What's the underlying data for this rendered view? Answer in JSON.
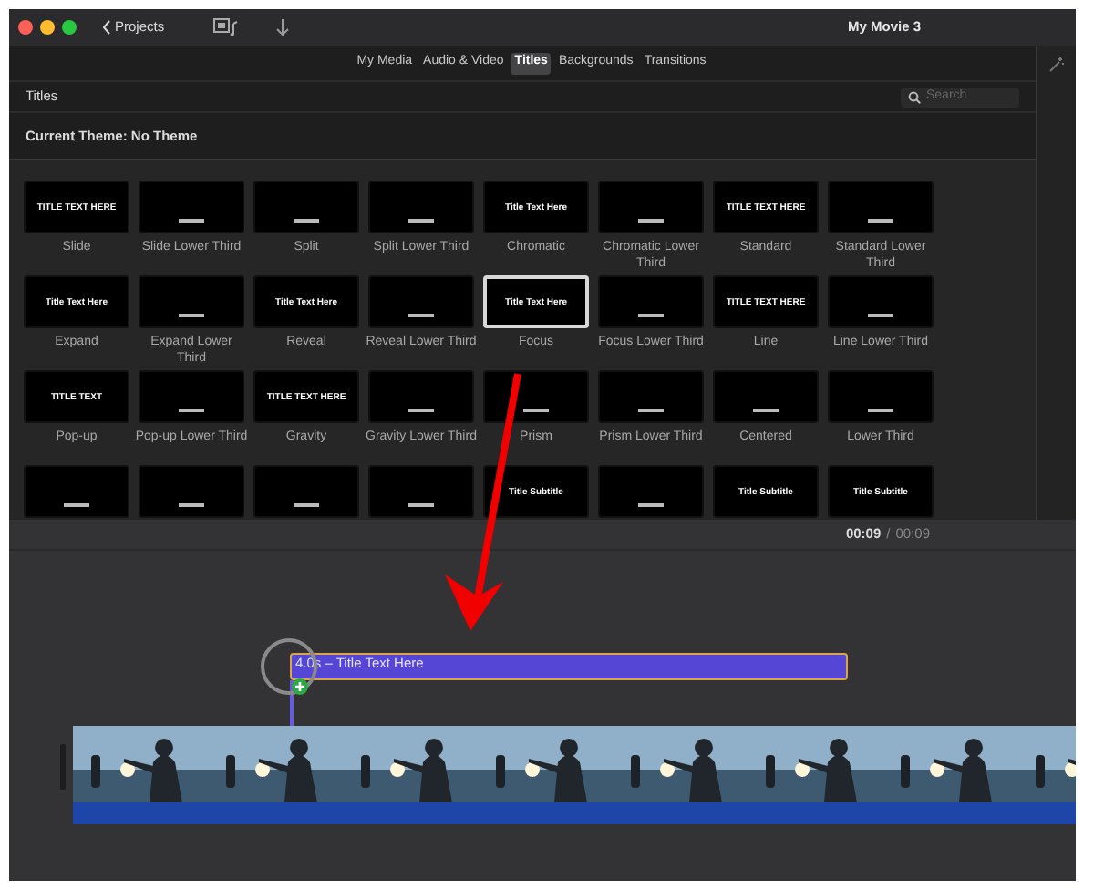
{
  "toolbar": {
    "back": "Projects",
    "title": "My Movie 3"
  },
  "tabs": [
    {
      "label": "My Media",
      "selected": false
    },
    {
      "label": "Audio & Video",
      "selected": false
    },
    {
      "label": "Titles",
      "selected": true
    },
    {
      "label": "Backgrounds",
      "selected": false
    },
    {
      "label": "Transitions",
      "selected": false
    }
  ],
  "browser": {
    "heading": "Titles",
    "search": {
      "placeholder": "Search"
    },
    "theme": "Current Theme: No Theme"
  },
  "titles": [
    {
      "label": "Slide",
      "selected": false,
      "preview": "TITLE TEXT HERE"
    },
    {
      "label": "Slide Lower Third",
      "selected": false
    },
    {
      "label": "Split",
      "selected": false
    },
    {
      "label": "Split Lower Third",
      "selected": false
    },
    {
      "label": "Chromatic",
      "selected": false,
      "preview": "Title Text Here"
    },
    {
      "label": "Chromatic Lower Third",
      "selected": false
    },
    {
      "label": "Standard",
      "selected": false,
      "preview": "TITLE TEXT HERE"
    },
    {
      "label": "Standard Lower Third",
      "selected": false
    },
    {
      "label": "Expand",
      "selected": false,
      "preview": "Title Text Here"
    },
    {
      "label": "Expand Lower Third",
      "selected": false
    },
    {
      "label": "Reveal",
      "selected": false,
      "preview": "Title Text Here"
    },
    {
      "label": "Reveal Lower Third",
      "selected": false
    },
    {
      "label": "Focus",
      "selected": true,
      "preview": "Title Text Here"
    },
    {
      "label": "Focus Lower Third",
      "selected": false
    },
    {
      "label": "Line",
      "selected": false,
      "preview": "TITLE TEXT HERE"
    },
    {
      "label": "Line Lower Third",
      "selected": false
    },
    {
      "label": "Pop-up",
      "selected": false,
      "preview": "TITLE TEXT"
    },
    {
      "label": "Pop-up Lower Third",
      "selected": false
    },
    {
      "label": "Gravity",
      "selected": false,
      "preview": "TITLE TEXT HERE"
    },
    {
      "label": "Gravity Lower Third",
      "selected": false
    },
    {
      "label": "Prism",
      "selected": false
    },
    {
      "label": "Prism Lower Third",
      "selected": false
    },
    {
      "label": "Centered",
      "selected": false
    },
    {
      "label": "Lower Third",
      "selected": false
    },
    {
      "selected": false
    },
    {
      "selected": false
    },
    {
      "selected": false
    },
    {
      "selected": false
    },
    {
      "selected": false,
      "preview": "Title Subtitle"
    },
    {
      "selected": false
    },
    {
      "selected": false,
      "preview": "Title Subtitle"
    },
    {
      "selected": false,
      "preview": "Title Subtitle"
    }
  ],
  "timeline": {
    "current": "00:09",
    "separator": "/",
    "total": "00:09",
    "title_clip": "4.0s – Title Text Here"
  }
}
